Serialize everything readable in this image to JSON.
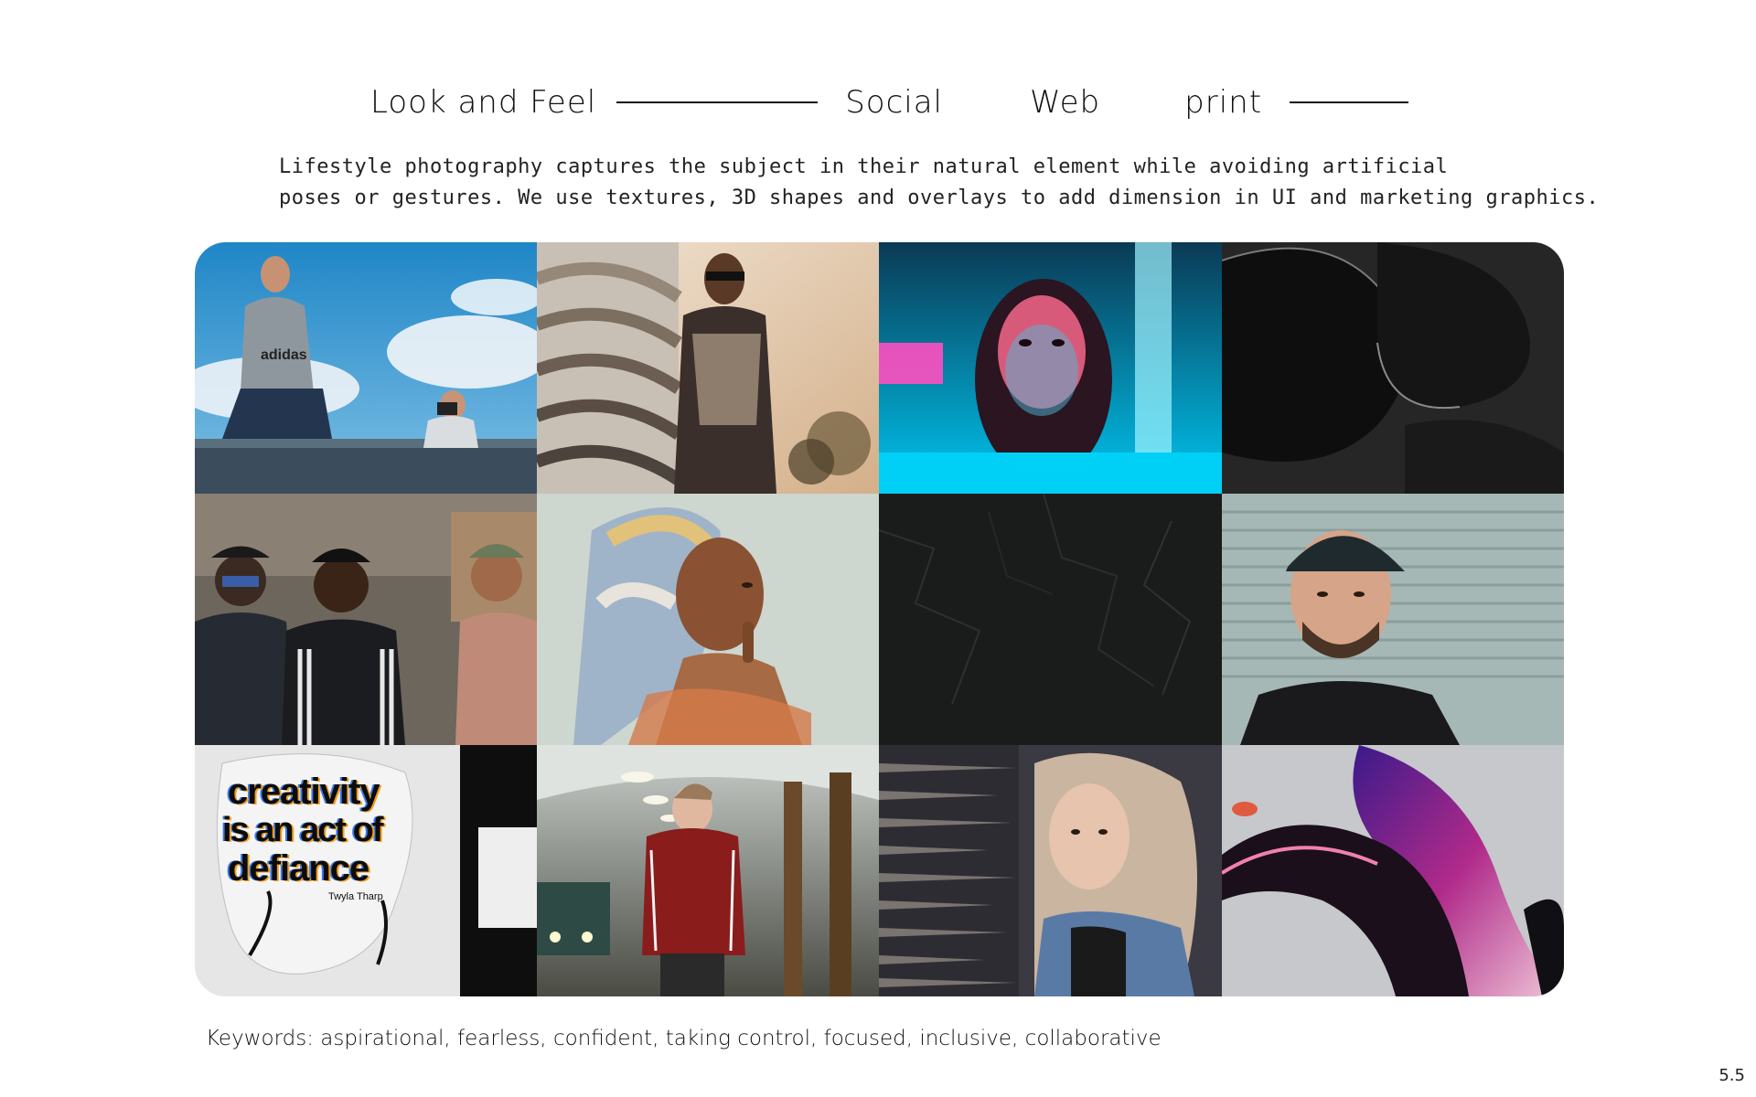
{
  "nav": {
    "items": [
      {
        "label": "Look and Feel"
      },
      {
        "label": "Social"
      },
      {
        "label": "Web"
      },
      {
        "label": "print"
      }
    ]
  },
  "description": {
    "line1": "Lifestyle photography captures the subject in their natural element while avoiding artificial",
    "line2": "poses or gestures. We use textures, 3D shapes and overlays to add dimension in UI and marketing graphics."
  },
  "gallery": {
    "tiles": [
      {
        "name": "photo-boys-on-bridge-sky",
        "colors": [
          "#2a8bc4",
          "#e9eef3"
        ],
        "shirt_text": "adidas"
      },
      {
        "name": "photo-man-sunglasses-texture",
        "colors": [
          "#c9a98a",
          "#3a2a22"
        ]
      },
      {
        "name": "photo-woman-neon-light",
        "colors": [
          "#00c2ee",
          "#ff2a6d"
        ]
      },
      {
        "name": "texture-black-3d-blobs",
        "colors": [
          "#1a1a1a",
          "#3c3c3c"
        ]
      },
      {
        "name": "photo-friends-laughing-street",
        "colors": [
          "#6a6157",
          "#1e1d22"
        ]
      },
      {
        "name": "photo-woman-headscarf",
        "colors": [
          "#cfd8d2",
          "#8a5a3e"
        ]
      },
      {
        "name": "texture-black-crumpled-paper",
        "colors": [
          "#1b1b1b",
          "#2b2b2b"
        ]
      },
      {
        "name": "photo-man-cap-portrait",
        "colors": [
          "#9fb2b0",
          "#1f2326"
        ]
      },
      {
        "name": "poster-creativity-defiance",
        "colors": [
          "#e8e8e8",
          "#111111"
        ],
        "poster_lines": [
          "creativity",
          "is an act of",
          "defiance"
        ],
        "poster_credit": "Twyla Tharp"
      },
      {
        "name": "photo-teen-subway-station",
        "colors": [
          "#b9c0bd",
          "#7a1c1c"
        ]
      },
      {
        "name": "photo-woman-glitch-portrait",
        "colors": [
          "#3a3840",
          "#c7b7a5"
        ]
      },
      {
        "name": "texture-pink-3d-shape",
        "colors": [
          "#c7c9cc",
          "#9b1f6d"
        ]
      }
    ]
  },
  "footer": {
    "keywords": "Keywords: aspirational, fearless, confident, taking control, focused, inclusive, collaborative",
    "page_number": "5.5"
  }
}
